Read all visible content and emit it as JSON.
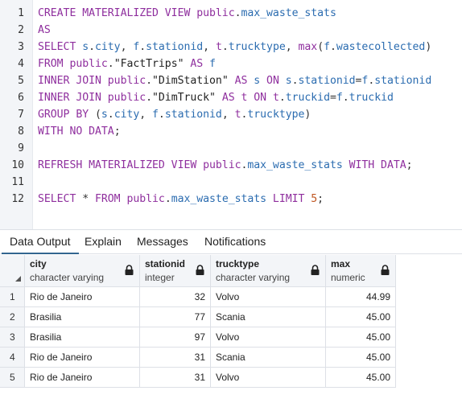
{
  "editor": {
    "line_numbers": [
      "1",
      "2",
      "3",
      "4",
      "5",
      "6",
      "7",
      "8",
      "9",
      "10",
      "11",
      "12"
    ],
    "lines": [
      [
        [
          "kw",
          "CREATE MATERIALIZED VIEW "
        ],
        [
          "kw",
          "public"
        ],
        [
          "op",
          "."
        ],
        [
          "id",
          "max_waste_stats"
        ]
      ],
      [
        [
          "kw",
          "AS"
        ]
      ],
      [
        [
          "kw",
          "SELECT "
        ],
        [
          "id",
          "s"
        ],
        [
          "op",
          "."
        ],
        [
          "id",
          "city"
        ],
        [
          "op",
          ", "
        ],
        [
          "id",
          "f"
        ],
        [
          "op",
          "."
        ],
        [
          "id",
          "stationid"
        ],
        [
          "op",
          ", "
        ],
        [
          "kw",
          "t"
        ],
        [
          "op",
          "."
        ],
        [
          "id",
          "trucktype"
        ],
        [
          "op",
          ", "
        ],
        [
          "kw",
          "max"
        ],
        [
          "op",
          "("
        ],
        [
          "id",
          "f"
        ],
        [
          "op",
          "."
        ],
        [
          "id",
          "wastecollected"
        ],
        [
          "op",
          ")"
        ]
      ],
      [
        [
          "kw",
          "FROM "
        ],
        [
          "kw",
          "public"
        ],
        [
          "op",
          "."
        ],
        [
          "str",
          "\"FactTrips\""
        ],
        [
          "kw",
          " AS "
        ],
        [
          "id",
          "f"
        ]
      ],
      [
        [
          "kw",
          "INNER JOIN "
        ],
        [
          "kw",
          "public"
        ],
        [
          "op",
          "."
        ],
        [
          "str",
          "\"DimStation\""
        ],
        [
          "kw",
          " AS "
        ],
        [
          "id",
          "s"
        ],
        [
          "kw",
          " ON "
        ],
        [
          "id",
          "s"
        ],
        [
          "op",
          "."
        ],
        [
          "id",
          "stationid"
        ],
        [
          "op",
          "="
        ],
        [
          "id",
          "f"
        ],
        [
          "op",
          "."
        ],
        [
          "id",
          "stationid"
        ]
      ],
      [
        [
          "kw",
          "INNER JOIN "
        ],
        [
          "kw",
          "public"
        ],
        [
          "op",
          "."
        ],
        [
          "str",
          "\"DimTruck\""
        ],
        [
          "kw",
          " AS "
        ],
        [
          "kw",
          "t"
        ],
        [
          "kw",
          " ON "
        ],
        [
          "kw",
          "t"
        ],
        [
          "op",
          "."
        ],
        [
          "id",
          "truckid"
        ],
        [
          "op",
          "="
        ],
        [
          "id",
          "f"
        ],
        [
          "op",
          "."
        ],
        [
          "id",
          "truckid"
        ]
      ],
      [
        [
          "kw",
          "GROUP BY "
        ],
        [
          "op",
          "("
        ],
        [
          "id",
          "s"
        ],
        [
          "op",
          "."
        ],
        [
          "id",
          "city"
        ],
        [
          "op",
          ", "
        ],
        [
          "id",
          "f"
        ],
        [
          "op",
          "."
        ],
        [
          "id",
          "stationid"
        ],
        [
          "op",
          ", "
        ],
        [
          "kw",
          "t"
        ],
        [
          "op",
          "."
        ],
        [
          "id",
          "trucktype"
        ],
        [
          "op",
          ")"
        ]
      ],
      [
        [
          "kw",
          "WITH NO DATA"
        ],
        [
          "op",
          ";"
        ]
      ],
      [],
      [
        [
          "kw",
          "REFRESH MATERIALIZED VIEW "
        ],
        [
          "kw",
          "public"
        ],
        [
          "op",
          "."
        ],
        [
          "id",
          "max_waste_stats"
        ],
        [
          "kw",
          " WITH DATA"
        ],
        [
          "op",
          ";"
        ]
      ],
      [],
      [
        [
          "kw",
          "SELECT "
        ],
        [
          "op",
          "* "
        ],
        [
          "kw",
          "FROM "
        ],
        [
          "kw",
          "public"
        ],
        [
          "op",
          "."
        ],
        [
          "id",
          "max_waste_stats"
        ],
        [
          "kw",
          " LIMIT "
        ],
        [
          "num",
          "5"
        ],
        [
          "op",
          ";"
        ]
      ]
    ]
  },
  "tabs": [
    {
      "label": "Data Output",
      "active": true
    },
    {
      "label": "Explain",
      "active": false
    },
    {
      "label": "Messages",
      "active": false
    },
    {
      "label": "Notifications",
      "active": false
    }
  ],
  "grid": {
    "columns": [
      {
        "name": "city",
        "type": "character varying"
      },
      {
        "name": "stationid",
        "type": "integer"
      },
      {
        "name": "trucktype",
        "type": "character varying"
      },
      {
        "name": "max",
        "type": "numeric"
      }
    ],
    "rows": [
      {
        "n": "1",
        "city": "Rio de Janeiro",
        "stationid": "32",
        "trucktype": "Volvo",
        "max": "44.99"
      },
      {
        "n": "2",
        "city": "Brasilia",
        "stationid": "77",
        "trucktype": "Scania",
        "max": "45.00"
      },
      {
        "n": "3",
        "city": "Brasilia",
        "stationid": "97",
        "trucktype": "Volvo",
        "max": "45.00"
      },
      {
        "n": "4",
        "city": "Rio de Janeiro",
        "stationid": "31",
        "trucktype": "Scania",
        "max": "45.00"
      },
      {
        "n": "5",
        "city": "Rio de Janeiro",
        "stationid": "31",
        "trucktype": "Volvo",
        "max": "45.00"
      }
    ]
  },
  "colors": {
    "keyword": "#8f2f9e",
    "identifier": "#2b6cb0",
    "number": "#c05621",
    "active_tab": "#326690"
  }
}
